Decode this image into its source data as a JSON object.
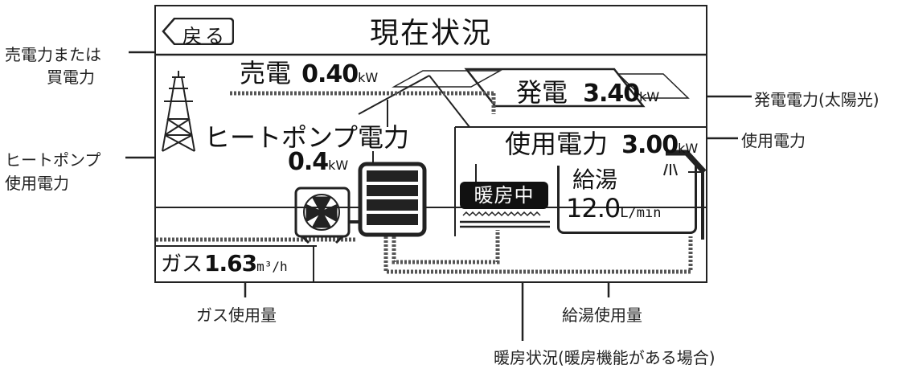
{
  "screen": {
    "back_label": "戻る",
    "title": "現在状況",
    "sell": {
      "label": "売電",
      "value": "0.40",
      "unit": "kW"
    },
    "generation": {
      "label": "発電",
      "value": "3.40",
      "unit": "kW"
    },
    "heatpump": {
      "label": "ヒートポンプ電力",
      "value": "0.4",
      "unit": "kW"
    },
    "usage": {
      "label": "使用電力",
      "value": "3.00",
      "unit": "kW"
    },
    "heating_status": "暖房中",
    "hotwater": {
      "label": "給湯",
      "value": "12.0",
      "unit": "L/min"
    },
    "gas": {
      "label": "ガス",
      "value": "1.63",
      "unit": "m³/h"
    }
  },
  "callouts": {
    "sell_power_line1": "売電力または",
    "sell_power_line2": "買電力",
    "generation_power": "発電電力(太陽光)",
    "usage_power": "使用電力",
    "heatpump_line1": "ヒートポンプ",
    "heatpump_line2": "使用電力",
    "gas_usage": "ガス使用量",
    "hotwater_usage": "給湯使用量",
    "heating_status": "暖房状況(暖房機能がある場合)"
  }
}
